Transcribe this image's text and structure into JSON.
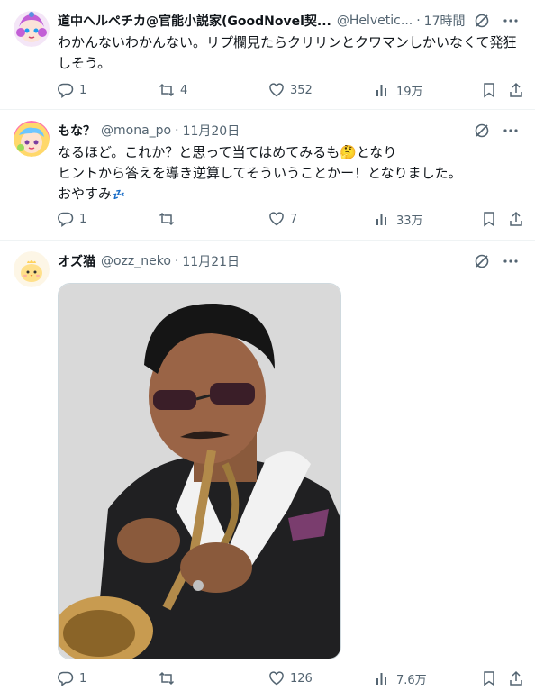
{
  "tweets": [
    {
      "name": "道中ヘルペチカ@官能小説家(GoodNovel契...",
      "handle": "@Helvetic...",
      "time": "17時間",
      "body_lines": [
        "わかんないわかんない。リプ欄見たらクリリンとクワマンしかいなくて発狂",
        "しそう。"
      ],
      "replies": "1",
      "retweets": "4",
      "likes": "352",
      "views": "19万",
      "avatar": "avatar-anime-girl-purple"
    },
    {
      "name": "もな？",
      "handle": "@mona_po",
      "time": "11月20日",
      "body_lines": [
        "なるほど。これか？と思って当てはめてみるも🤔となり",
        "ヒントから答えを導き逆算してそういうことかー！となりました。",
        "おやすみ"
      ],
      "sleep_emoji": "💤",
      "replies": "1",
      "retweets": "",
      "likes": "7",
      "views": "33万",
      "avatar": "avatar-colorful-girl"
    },
    {
      "name": "オズ猫",
      "handle": "@ozz_neko",
      "time": "11月21日",
      "body_lines": [],
      "replies": "1",
      "retweets": "",
      "likes": "126",
      "views": "7.6万",
      "avatar": "avatar-yellow-chick",
      "media": "photo-man-playing-trumpet"
    }
  ],
  "colors": {
    "text": "#0f1419",
    "muted": "#536471",
    "divider": "#eff3f4",
    "grok": "#536471"
  },
  "icons": [
    "grok-icon",
    "more-icon",
    "reply-icon",
    "retweet-icon",
    "like-icon",
    "views-icon",
    "bookmark-icon",
    "share-icon"
  ]
}
